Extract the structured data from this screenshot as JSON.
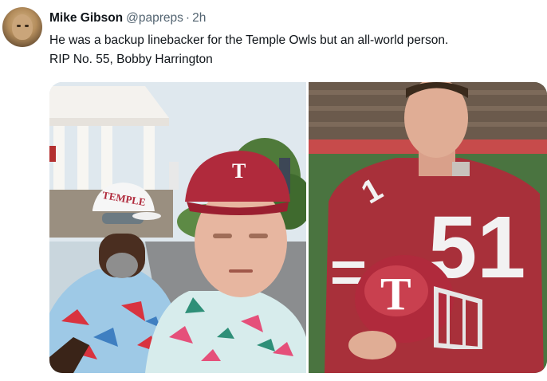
{
  "tweet": {
    "author_name": "Mike Gibson",
    "handle": "@papreps",
    "separator": "·",
    "time": "2h",
    "text_lines": [
      "He was a backup linebacker for the Temple Owls but an all-world person.",
      "RIP No. 55, Bobby Harrington"
    ]
  },
  "media": {
    "left_photo": {
      "cap_text_a": "TEMPLE",
      "cap_text_b": "T"
    },
    "right_photo": {
      "jersey_number": "51",
      "shoulder_number": "1",
      "helmet_letter": "T"
    }
  },
  "colors": {
    "temple_red": "#b02a3c",
    "handle_gray": "#536471",
    "text": "#0f1419"
  }
}
